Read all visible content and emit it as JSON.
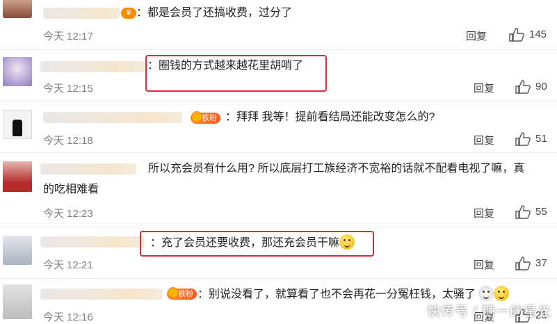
{
  "reply_label": "回复",
  "comments": [
    {
      "text": "：都是会员了还搞收费，过分了",
      "time": "今天 12:17",
      "likes": "145"
    },
    {
      "text": "：圈钱的方式越来越花里胡哨了",
      "time": "今天 12:15",
      "likes": "90"
    },
    {
      "badge": "铁粉",
      "text": "：拜拜  我等！提前看结局还能改变怎么的?",
      "time": "今天 12:18",
      "likes": "51"
    },
    {
      "text_line1": "所以充会员有什么用? 所以底层打工族经济不宽裕的话就不配看电视了嘛，真",
      "text_line2": "的吃相难看",
      "time": "今天 12:23",
      "likes": "55"
    },
    {
      "text": "：充了会员还要收费，那还充会员干嘛",
      "time": "今天 12:21",
      "likes": "37"
    },
    {
      "badge": "铁粉",
      "text": "：别说没看了，就算看了也不会再花一分冤枉钱，太骚了",
      "time": "今天 12:16",
      "likes": "23"
    }
  ],
  "watermark": "快传号 / 糖一的星光",
  "colors": {
    "highlight": "#e0283a",
    "badge": "#ff5a1f",
    "time": "#808080"
  }
}
